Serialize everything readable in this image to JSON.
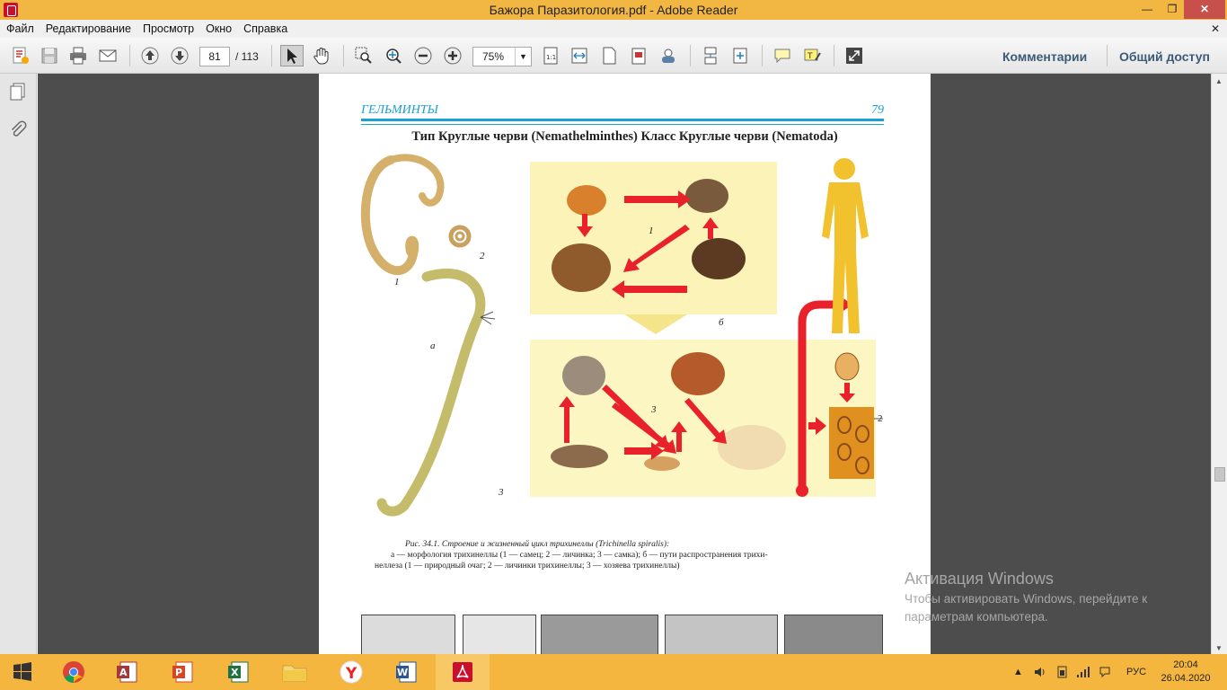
{
  "window": {
    "title": "Бажора Паразитология.pdf - Adobe Reader",
    "min_glyph": "—",
    "max_glyph": "❐",
    "close_glyph": "✕"
  },
  "menu": {
    "items": [
      "Файл",
      "Редактирование",
      "Просмотр",
      "Окно",
      "Справка"
    ],
    "close_glyph": "✕"
  },
  "toolbar": {
    "current_page": "81",
    "total_pages": "/ 113",
    "zoom": "75%",
    "zoom_dropdown": "▼",
    "comments_label": "Комментарии",
    "share_label": "Общий доступ"
  },
  "document": {
    "section": "ГЕЛЬМИНТЫ",
    "page_number": "79",
    "title": "Тип Круглые черви (Nemathelminthes) Класс Круглые черви (Nematoda)",
    "labels": {
      "n1": "1",
      "n2": "2",
      "a": "а",
      "n3": "3",
      "cycle1": "1",
      "b": "б",
      "cycle3": "3",
      "larvae2": "2"
    },
    "caption": {
      "line1": "Рис. 34.1. Строение и жизненный цикл трихинеллы (Trichinella spiralis):",
      "line2": "а — морфология трихинеллы (1 — самец; 2 — личинка; 3 — самка); б — пути распространения трихи-",
      "line3": "неллеза (1 — природный очаг; 2 — личинки трихинеллы; 3 — хозяева трихинеллы)"
    }
  },
  "watermark": {
    "title": "Активация Windows",
    "text": "Чтобы активировать Windows, перейдите к параметрам компьютера."
  },
  "taskbar": {
    "language": "РУС",
    "time": "20:04",
    "date": "26.04.2020"
  },
  "colors": {
    "titlebar": "#f2b642",
    "taskbar": "#f5b63f",
    "accent_blue": "#1aa0d8",
    "arrow_red": "#e8212b"
  }
}
